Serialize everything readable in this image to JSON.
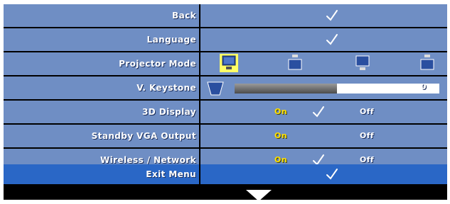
{
  "menu": {
    "rows": [
      {
        "label": "Back"
      },
      {
        "label": "Language"
      },
      {
        "label": "Projector Mode",
        "modes": [
          "front-projection-desktop-icon",
          "front-projection-ceiling-icon",
          "rear-projection-desktop-icon",
          "rear-projection-ceiling-icon"
        ],
        "selected_mode_index": 0
      },
      {
        "label": "V. Keystone",
        "slider_value": "0",
        "slider_fraction": 0.5
      },
      {
        "label": "3D Display",
        "on": "On",
        "off": "Off"
      },
      {
        "label": "Standby VGA Output",
        "on": "On",
        "off": "Off"
      },
      {
        "label": "Wireless / Network",
        "on": "On",
        "off": "Off"
      }
    ],
    "exit_label": "Exit Menu"
  },
  "colors": {
    "row_bg": "#6f8ec4",
    "exit_bg": "#2a67c6",
    "on_text": "#ffe000",
    "off_text": "#ffffff",
    "selected_highlight": "#ffff66"
  },
  "icons": {
    "check": "check-icon",
    "down_arrow": "down-arrow-icon",
    "keystone": "keystone-icon"
  }
}
